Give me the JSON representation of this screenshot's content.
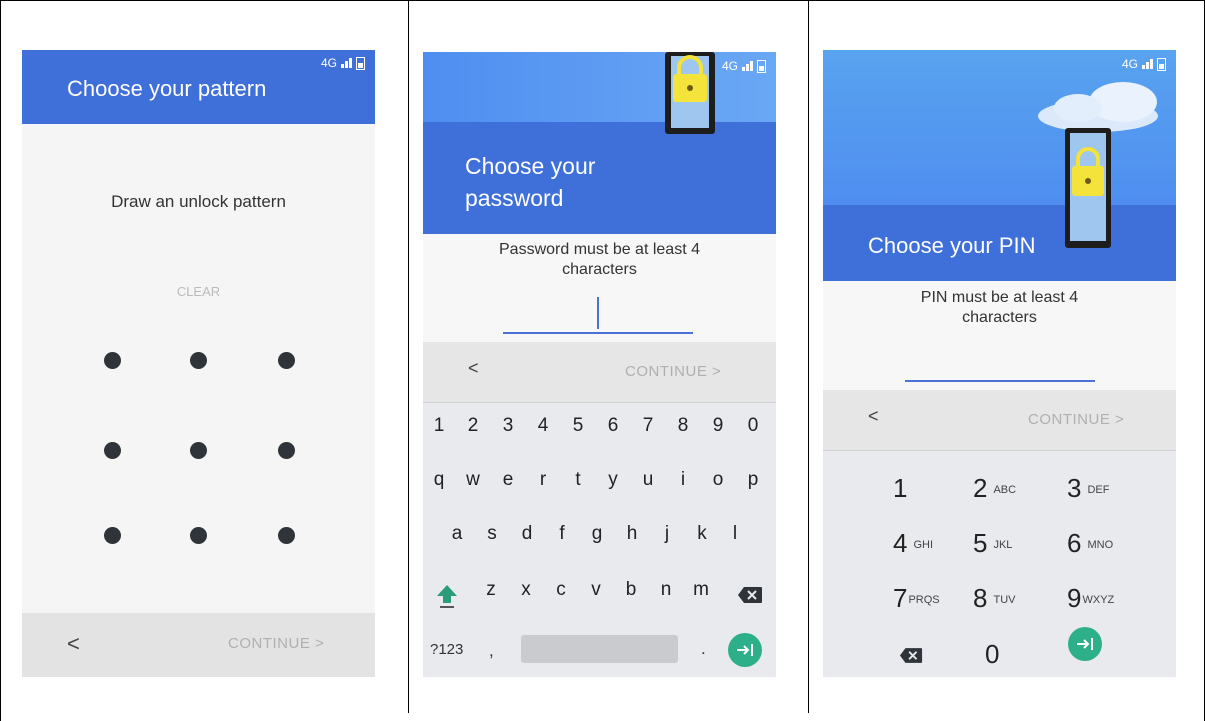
{
  "pattern_screen": {
    "status": {
      "network": "4G"
    },
    "title": "Choose your pattern",
    "instruction": "Draw an unlock pattern",
    "clear_label": "CLEAR",
    "back_label": "<",
    "continue_label": "CONTINUE >"
  },
  "password_screen": {
    "status": {
      "network": "4G"
    },
    "title": "Choose your password",
    "title_line1": "Choose your",
    "title_line2": "password",
    "hint_line1": "Password must be at least 4",
    "hint_line2": "characters",
    "back_label": "<",
    "continue_label": "CONTINUE >",
    "keyboard": {
      "row_numbers": [
        "1",
        "2",
        "3",
        "4",
        "5",
        "6",
        "7",
        "8",
        "9",
        "0"
      ],
      "row1": [
        "q",
        "w",
        "e",
        "r",
        "t",
        "y",
        "u",
        "i",
        "o",
        "p"
      ],
      "row2": [
        "a",
        "s",
        "d",
        "f",
        "g",
        "h",
        "j",
        "k",
        "l"
      ],
      "row3": [
        "z",
        "x",
        "c",
        "v",
        "b",
        "n",
        "m"
      ],
      "symbols_label": "?123",
      "comma": ",",
      "period": "."
    }
  },
  "pin_screen": {
    "status": {
      "network": "4G"
    },
    "title": "Choose your PIN",
    "hint_line1": "PIN must be at least 4",
    "hint_line2": "characters",
    "back_label": "<",
    "continue_label": "CONTINUE >",
    "keypad": [
      {
        "digit": "1",
        "letters": ""
      },
      {
        "digit": "2",
        "letters": "ABC"
      },
      {
        "digit": "3",
        "letters": "DEF"
      },
      {
        "digit": "4",
        "letters": "GHI"
      },
      {
        "digit": "5",
        "letters": "JKL"
      },
      {
        "digit": "6",
        "letters": "MNO"
      },
      {
        "digit": "7",
        "letters": "PRQS"
      },
      {
        "digit": "8",
        "letters": "TUV"
      },
      {
        "digit": "9",
        "letters": "WXYZ"
      },
      {
        "digit": "0",
        "letters": ""
      }
    ]
  },
  "colors": {
    "header_blue": "#3f6fd8",
    "action_green": "#2db08a",
    "dot": "#2e3439"
  }
}
